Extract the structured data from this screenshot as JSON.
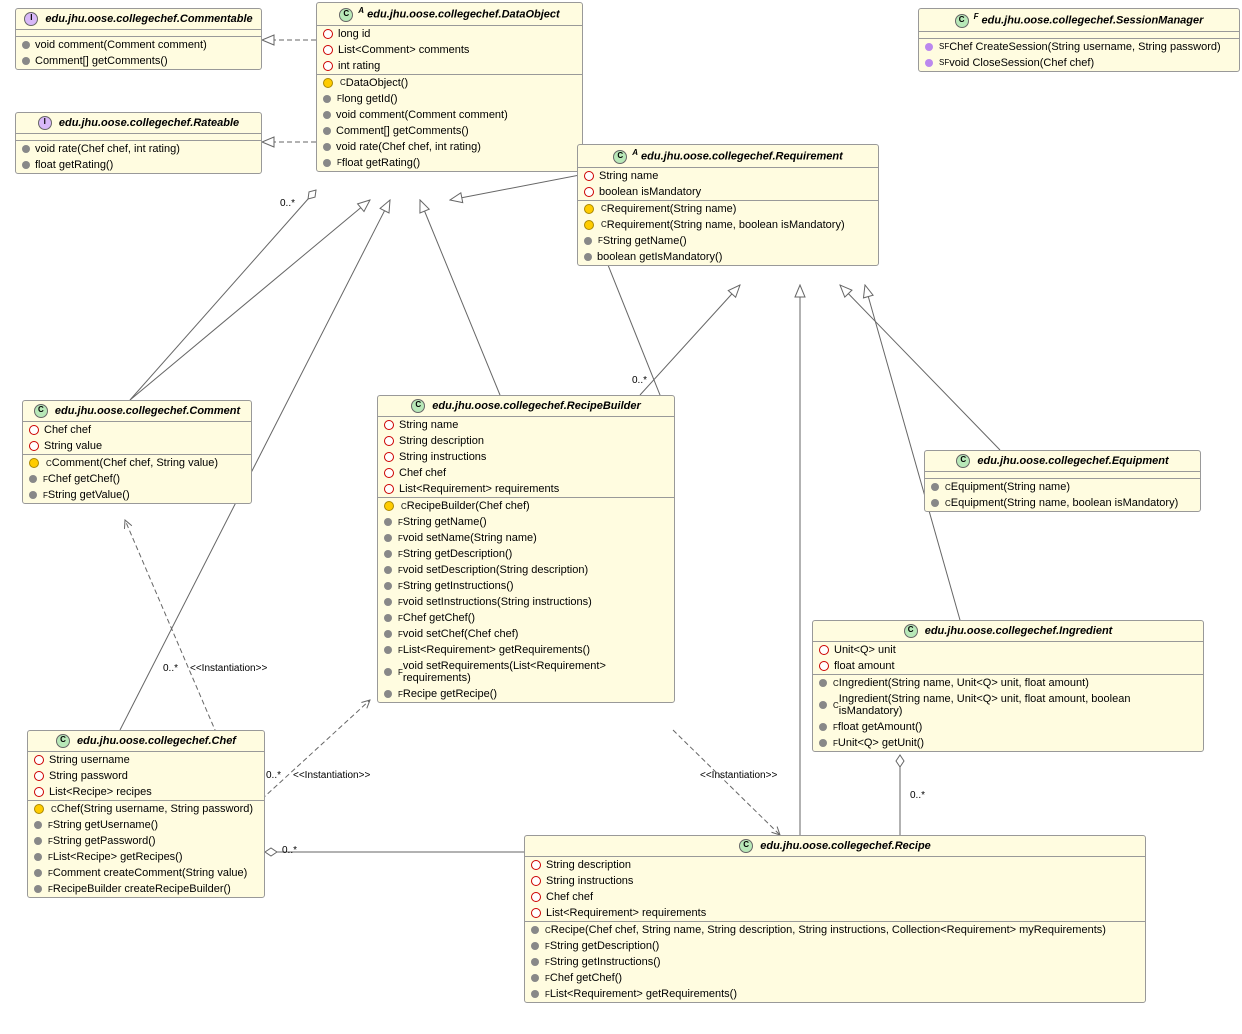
{
  "classes": {
    "Commentable": {
      "badge": "I",
      "title": "edu.jhu.oose.collegechef.Commentable",
      "attrs": [],
      "ops": [
        {
          "k": "grey",
          "t": "void comment(Comment comment)"
        },
        {
          "k": "grey",
          "t": "Comment[] getComments()"
        }
      ]
    },
    "Rateable": {
      "badge": "I",
      "title": "edu.jhu.oose.collegechef.Rateable",
      "attrs": [],
      "ops": [
        {
          "k": "grey",
          "t": "void rate(Chef chef, int rating)"
        },
        {
          "k": "grey",
          "t": "float getRating()"
        }
      ]
    },
    "DataObject": {
      "badge": "C",
      "badgeSup": "A",
      "title": "edu.jhu.oose.collegechef.DataObject",
      "attrs": [
        {
          "k": "red",
          "t": "long id"
        },
        {
          "k": "red",
          "t": "List<Comment> comments"
        },
        {
          "k": "red",
          "t": "int rating"
        }
      ],
      "ops": [
        {
          "k": "ydiamond",
          "sup": "C",
          "t": "DataObject()"
        },
        {
          "k": "grey",
          "sup": "F",
          "t": "long getId()"
        },
        {
          "k": "grey",
          "t": "void comment(Comment comment)"
        },
        {
          "k": "grey",
          "t": "Comment[] getComments()"
        },
        {
          "k": "grey",
          "t": "void rate(Chef chef, int rating)"
        },
        {
          "k": "grey",
          "sup": "F",
          "t": "float getRating()"
        }
      ]
    },
    "SessionManager": {
      "badge": "C",
      "badgeSup": "F",
      "title": "edu.jhu.oose.collegechef.SessionManager",
      "attrs": [],
      "ops": [
        {
          "k": "purple",
          "sup": "SF",
          "t": "Chef CreateSession(String username, String password)"
        },
        {
          "k": "purple",
          "sup": "SF",
          "t": "void CloseSession(Chef chef)"
        }
      ]
    },
    "Requirement": {
      "badge": "C",
      "badgeSup": "A",
      "title": "edu.jhu.oose.collegechef.Requirement",
      "attrs": [
        {
          "k": "red",
          "t": "String name"
        },
        {
          "k": "red",
          "t": "boolean isMandatory"
        }
      ],
      "ops": [
        {
          "k": "ydiamond",
          "sup": "C",
          "t": "Requirement(String name)"
        },
        {
          "k": "ydiamond",
          "sup": "C",
          "t": "Requirement(String name, boolean isMandatory)"
        },
        {
          "k": "grey",
          "sup": "F",
          "t": "String getName()"
        },
        {
          "k": "grey",
          "t": "boolean getIsMandatory()"
        }
      ]
    },
    "Comment": {
      "badge": "C",
      "title": "edu.jhu.oose.collegechef.Comment",
      "attrs": [
        {
          "k": "red",
          "t": "Chef chef"
        },
        {
          "k": "red",
          "t": "String value"
        }
      ],
      "ops": [
        {
          "k": "ydiamond",
          "sup": "C",
          "t": "Comment(Chef chef, String value)"
        },
        {
          "k": "grey",
          "sup": "F",
          "t": "Chef getChef()"
        },
        {
          "k": "grey",
          "sup": "F",
          "t": "String getValue()"
        }
      ]
    },
    "RecipeBuilder": {
      "badge": "C",
      "title": "edu.jhu.oose.collegechef.RecipeBuilder",
      "attrs": [
        {
          "k": "red",
          "t": "String name"
        },
        {
          "k": "red",
          "t": "String description"
        },
        {
          "k": "red",
          "t": "String instructions"
        },
        {
          "k": "red",
          "t": "Chef chef"
        },
        {
          "k": "red",
          "t": "List<Requirement> requirements"
        }
      ],
      "ops": [
        {
          "k": "ydiamond",
          "sup": "C",
          "t": "RecipeBuilder(Chef chef)"
        },
        {
          "k": "grey",
          "sup": "F",
          "t": "String getName()"
        },
        {
          "k": "grey",
          "sup": "F",
          "t": "void setName(String name)"
        },
        {
          "k": "grey",
          "sup": "F",
          "t": "String getDescription()"
        },
        {
          "k": "grey",
          "sup": "F",
          "t": "void setDescription(String description)"
        },
        {
          "k": "grey",
          "sup": "F",
          "t": "String getInstructions()"
        },
        {
          "k": "grey",
          "sup": "F",
          "t": "void setInstructions(String instructions)"
        },
        {
          "k": "grey",
          "sup": "F",
          "t": "Chef getChef()"
        },
        {
          "k": "grey",
          "sup": "F",
          "t": "void setChef(Chef chef)"
        },
        {
          "k": "grey",
          "sup": "F",
          "t": "List<Requirement> getRequirements()"
        },
        {
          "k": "grey",
          "sup": "F",
          "t": "void setRequirements(List<Requirement> requirements)"
        },
        {
          "k": "grey",
          "sup": "F",
          "t": "Recipe getRecipe()"
        }
      ]
    },
    "Equipment": {
      "badge": "C",
      "title": "edu.jhu.oose.collegechef.Equipment",
      "attrs": [],
      "ops": [
        {
          "k": "grey",
          "sup": "C",
          "t": "Equipment(String name)"
        },
        {
          "k": "grey",
          "sup": "C",
          "t": "Equipment(String name, boolean isMandatory)"
        }
      ]
    },
    "Ingredient": {
      "badge": "C",
      "title": "edu.jhu.oose.collegechef.Ingredient",
      "attrs": [
        {
          "k": "red",
          "t": "Unit<Q> unit"
        },
        {
          "k": "red",
          "t": "float amount"
        }
      ],
      "ops": [
        {
          "k": "grey",
          "sup": "C",
          "t": "Ingredient(String name, Unit<Q> unit, float amount)"
        },
        {
          "k": "grey",
          "sup": "C",
          "t": "Ingredient(String name, Unit<Q> unit, float amount, boolean isMandatory)"
        },
        {
          "k": "grey",
          "sup": "F",
          "t": "float getAmount()"
        },
        {
          "k": "grey",
          "sup": "F",
          "t": "Unit<Q> getUnit()"
        }
      ]
    },
    "Chef": {
      "badge": "C",
      "title": "edu.jhu.oose.collegechef.Chef",
      "attrs": [
        {
          "k": "red",
          "t": "String username"
        },
        {
          "k": "red",
          "t": "String password"
        },
        {
          "k": "red",
          "t": "List<Recipe> recipes"
        }
      ],
      "ops": [
        {
          "k": "ydiamond",
          "sup": "C",
          "t": "Chef(String username, String password)"
        },
        {
          "k": "grey",
          "sup": "F",
          "t": "String getUsername()"
        },
        {
          "k": "grey",
          "sup": "F",
          "t": "String getPassword()"
        },
        {
          "k": "grey",
          "sup": "F",
          "t": "List<Recipe> getRecipes()"
        },
        {
          "k": "grey",
          "sup": "F",
          "t": "Comment createComment(String value)"
        },
        {
          "k": "grey",
          "sup": "F",
          "t": "RecipeBuilder createRecipeBuilder()"
        }
      ]
    },
    "Recipe": {
      "badge": "C",
      "title": "edu.jhu.oose.collegechef.Recipe",
      "attrs": [
        {
          "k": "red",
          "t": "String description"
        },
        {
          "k": "red",
          "t": "String instructions"
        },
        {
          "k": "red",
          "t": "Chef chef"
        },
        {
          "k": "red",
          "t": "List<Requirement> requirements"
        }
      ],
      "ops": [
        {
          "k": "grey",
          "sup": "C",
          "t": "Recipe(Chef chef, String name, String description, String instructions, Collection<Requirement> myRequirements)"
        },
        {
          "k": "grey",
          "sup": "F",
          "t": "String getDescription()"
        },
        {
          "k": "grey",
          "sup": "F",
          "t": "String getInstructions()"
        },
        {
          "k": "grey",
          "sup": "F",
          "t": "Chef getChef()"
        },
        {
          "k": "grey",
          "sup": "F",
          "t": "List<Requirement> getRequirements()"
        }
      ]
    }
  },
  "labels": {
    "m1": "0..*",
    "m2": "0..*",
    "m3": "0..*",
    "m4": "0..*",
    "m5": "0..*",
    "m6": "0..*",
    "i1": "<<Instantiation>>",
    "i2": "<<Instantiation>>",
    "i3": "<<Instantiation>>"
  }
}
